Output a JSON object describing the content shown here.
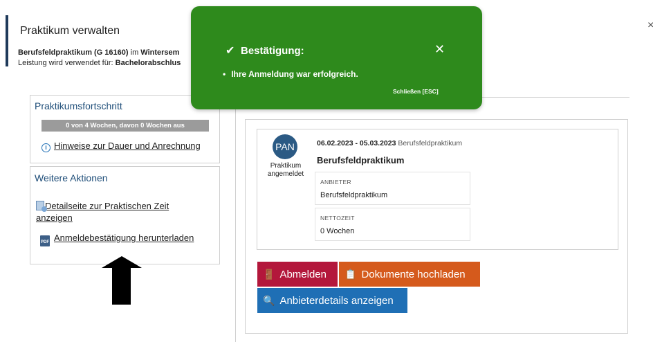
{
  "header": {
    "title": "Praktikum verwalten",
    "line1_bold": "Berufsfeldpraktikum (G 16160)",
    "line1_mid": " im ",
    "line1_bold2": "Wintersem",
    "line2_text": "Leistung wird verwendet für: ",
    "line2_bold": "Bachelorabschlus",
    "edge_close": "×"
  },
  "progress_panel": {
    "title": "Praktikumsfortschritt",
    "progress_text": "0 von 4 Wochen, davon 0 Wochen aus",
    "progress_fraction": 0,
    "info_link": "Hinweise zur Dauer und Anrechnung"
  },
  "actions_panel": {
    "title": "Weitere Aktionen",
    "detail_link": "Detailseite zur Praktischen Zeit anzeigen",
    "download_link": "Anmeldebestätigung herunterladen"
  },
  "entry": {
    "avatar": "PAN",
    "status": "Praktikum angemeldet",
    "date_range": "06.02.2023 - 05.03.2023",
    "date_type": "Berufsfeldpraktikum",
    "title": "Berufsfeldpraktikum",
    "fields": [
      {
        "label": "ANBIETER",
        "value": "Berufsfeldpraktikum"
      },
      {
        "label": "NETTOZEIT",
        "value": "0 Wochen"
      }
    ]
  },
  "buttons": {
    "abmelden": "Abmelden",
    "dokumente": "Dokumente hochladen",
    "anbieter": "Anbieterdetails anzeigen"
  },
  "toast": {
    "title": "Bestätigung:",
    "message": "Ihre Anmeldung war erfolgreich.",
    "close_hint": "Schließen [ESC]",
    "close_symbol": "✕",
    "check_symbol": "✔"
  },
  "colors": {
    "toast_green": "#2e8a1c",
    "abmelden_red": "#b3173b",
    "dokumente_orange": "#d55a1c",
    "anbieter_blue": "#1f6fb5",
    "avatar_blue": "#2b5a84"
  }
}
